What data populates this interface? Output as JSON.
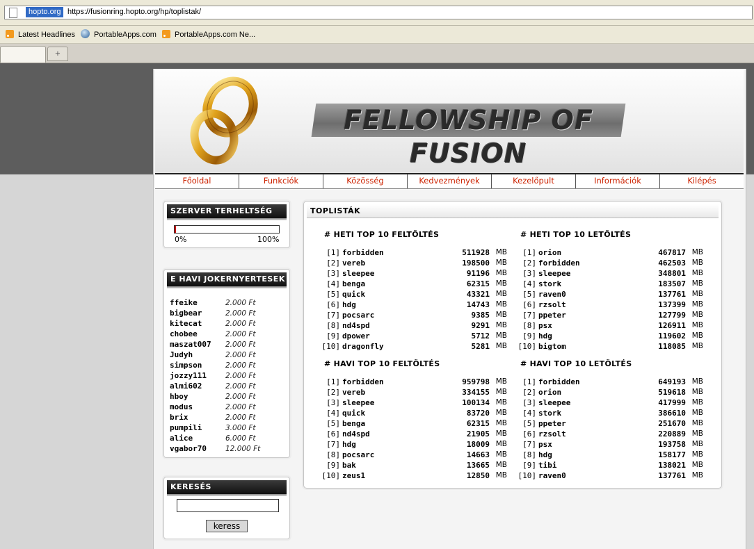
{
  "browser": {
    "domain_chip": "hopto.org",
    "url": "https://fusionring.hopto.org/hp/toplistak/",
    "bookmarks": [
      {
        "label": "Latest Headlines",
        "icon": "rss-icon"
      },
      {
        "label": "PortableApps.com",
        "icon": "globe-icon"
      },
      {
        "label": "PortableApps.com Ne...",
        "icon": "rss-icon"
      }
    ],
    "new_tab_symbol": "+"
  },
  "site": {
    "title": "FELLOWSHIP OF FUSION",
    "nav": [
      "Főoldal",
      "Funkciók",
      "Közösség",
      "Kedvezmények",
      "Kezelőpult",
      "Információk",
      "Kilépés"
    ]
  },
  "sidebar": {
    "server_load": {
      "title": "SZERVER TERHELTSÉG",
      "value_percent": 1,
      "min_label": "0%",
      "max_label": "100%"
    },
    "jackpot": {
      "title": "E HAVI JOKERNYERTESEK",
      "winners": [
        {
          "name": "ffeike",
          "amount": "2.000 Ft"
        },
        {
          "name": "bigbear",
          "amount": "2.000 Ft"
        },
        {
          "name": "kitecat",
          "amount": "2.000 Ft"
        },
        {
          "name": "chobee",
          "amount": "2.000 Ft"
        },
        {
          "name": "maszat007",
          "amount": "2.000 Ft"
        },
        {
          "name": "Judyh",
          "amount": "2.000 Ft"
        },
        {
          "name": "simpson",
          "amount": "2.000 Ft"
        },
        {
          "name": "jozzy111",
          "amount": "2.000 Ft"
        },
        {
          "name": "almi602",
          "amount": "2.000 Ft"
        },
        {
          "name": "hboy",
          "amount": "2.000 Ft"
        },
        {
          "name": "modus",
          "amount": "2.000 Ft"
        },
        {
          "name": "brix",
          "amount": "2.000 Ft"
        },
        {
          "name": "pumpili",
          "amount": "3.000 Ft"
        },
        {
          "name": "alice",
          "amount": "6.000 Ft"
        },
        {
          "name": "vgabor70",
          "amount": "12.000 Ft"
        }
      ]
    },
    "search": {
      "title": "KERESÉS",
      "value": "",
      "button": "keress"
    }
  },
  "main": {
    "title": "TOPLISTÁK",
    "unit": "MB",
    "lists": [
      {
        "title": "# HETI TOP 10 FELTÖLTÉS",
        "rows": [
          {
            "rank": "[1]",
            "name": "forbidden",
            "size": "511928"
          },
          {
            "rank": "[2]",
            "name": "vereb",
            "size": "198500"
          },
          {
            "rank": "[3]",
            "name": "sleepee",
            "size": "91196"
          },
          {
            "rank": "[4]",
            "name": "benga",
            "size": "62315"
          },
          {
            "rank": "[5]",
            "name": "quick",
            "size": "43321"
          },
          {
            "rank": "[6]",
            "name": "hdg",
            "size": "14743"
          },
          {
            "rank": "[7]",
            "name": "pocsarc",
            "size": "9385"
          },
          {
            "rank": "[8]",
            "name": "nd4spd",
            "size": "9291"
          },
          {
            "rank": "[9]",
            "name": "dpower",
            "size": "5712"
          },
          {
            "rank": "[10]",
            "name": "dragonfly",
            "size": "5281"
          }
        ]
      },
      {
        "title": "# HETI TOP 10 LETÖLTÉS",
        "rows": [
          {
            "rank": "[1]",
            "name": "orion",
            "size": "467817"
          },
          {
            "rank": "[2]",
            "name": "forbidden",
            "size": "462503"
          },
          {
            "rank": "[3]",
            "name": "sleepee",
            "size": "348801"
          },
          {
            "rank": "[4]",
            "name": "stork",
            "size": "183507"
          },
          {
            "rank": "[5]",
            "name": "raven0",
            "size": "137761"
          },
          {
            "rank": "[6]",
            "name": "rzsolt",
            "size": "137399"
          },
          {
            "rank": "[7]",
            "name": "ppeter",
            "size": "127799"
          },
          {
            "rank": "[8]",
            "name": "psx",
            "size": "126911"
          },
          {
            "rank": "[9]",
            "name": "hdg",
            "size": "119602"
          },
          {
            "rank": "[10]",
            "name": "bigtom",
            "size": "118085"
          }
        ]
      },
      {
        "title": "# HAVI TOP 10 FELTÖLTÉS",
        "rows": [
          {
            "rank": "[1]",
            "name": "forbidden",
            "size": "959798"
          },
          {
            "rank": "[2]",
            "name": "vereb",
            "size": "334155"
          },
          {
            "rank": "[3]",
            "name": "sleepee",
            "size": "100134"
          },
          {
            "rank": "[4]",
            "name": "quick",
            "size": "83720"
          },
          {
            "rank": "[5]",
            "name": "benga",
            "size": "62315"
          },
          {
            "rank": "[6]",
            "name": "nd4spd",
            "size": "21905"
          },
          {
            "rank": "[7]",
            "name": "hdg",
            "size": "18009"
          },
          {
            "rank": "[8]",
            "name": "pocsarc",
            "size": "14663"
          },
          {
            "rank": "[9]",
            "name": "bak",
            "size": "13665"
          },
          {
            "rank": "[10]",
            "name": "zeus1",
            "size": "12850"
          }
        ]
      },
      {
        "title": "# HAVI TOP 10 LETÖLTÉS",
        "rows": [
          {
            "rank": "[1]",
            "name": "forbidden",
            "size": "649193"
          },
          {
            "rank": "[2]",
            "name": "orion",
            "size": "519618"
          },
          {
            "rank": "[3]",
            "name": "sleepee",
            "size": "417999"
          },
          {
            "rank": "[4]",
            "name": "stork",
            "size": "386610"
          },
          {
            "rank": "[5]",
            "name": "ppeter",
            "size": "251670"
          },
          {
            "rank": "[6]",
            "name": "rzsolt",
            "size": "220889"
          },
          {
            "rank": "[7]",
            "name": "psx",
            "size": "193758"
          },
          {
            "rank": "[8]",
            "name": "hdg",
            "size": "158177"
          },
          {
            "rank": "[9]",
            "name": "tibi",
            "size": "138021"
          },
          {
            "rank": "[10]",
            "name": "raven0",
            "size": "137761"
          }
        ]
      }
    ]
  }
}
